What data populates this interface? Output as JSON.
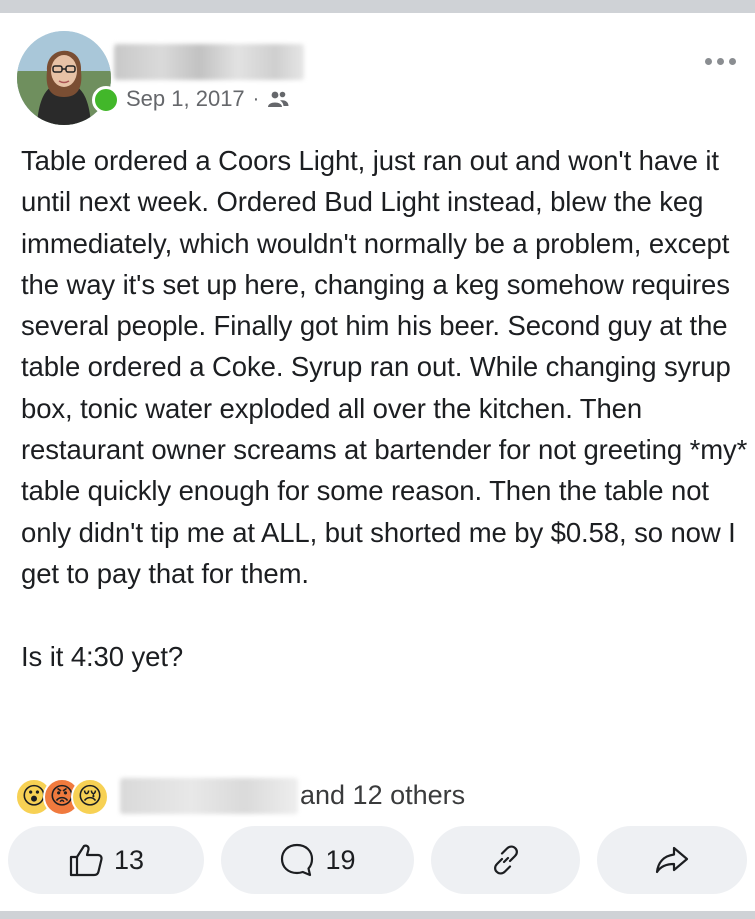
{
  "post": {
    "author_name": "",
    "date": "Sep 1, 2017",
    "separator": "·",
    "audience_icon": "friends-icon",
    "body_paragraphs": [
      "Table ordered a Coors Light, just ran out and won't have it until next week. Ordered Bud Light instead, blew the keg immediately, which wouldn't normally be a problem, except the way it's set up here, changing a keg somehow requires several people. Finally got him his beer. Second guy at the table ordered a Coke. Syrup ran out. While changing syrup box, tonic water exploded all over the kitchen. Then restaurant owner screams at bartender for not greeting *my* table quickly enough for some reason. Then the table not only didn't tip me at ALL, but shorted me by $0.58, so now I get to pay that for them.",
      "Is it 4:30 yet?"
    ]
  },
  "reactions": {
    "emojis": [
      {
        "name": "wow-reaction-icon",
        "glyph": "😮"
      },
      {
        "name": "angry-reaction-icon",
        "glyph": "😡"
      },
      {
        "name": "sad-reaction-icon",
        "glyph": "😢"
      }
    ],
    "others_text": "and 12 others"
  },
  "actions": {
    "like_count": "13",
    "comment_count": "19"
  },
  "colors": {
    "online": "#42b72a",
    "button_bg": "#eef0f3",
    "meta_text": "#65676b"
  }
}
